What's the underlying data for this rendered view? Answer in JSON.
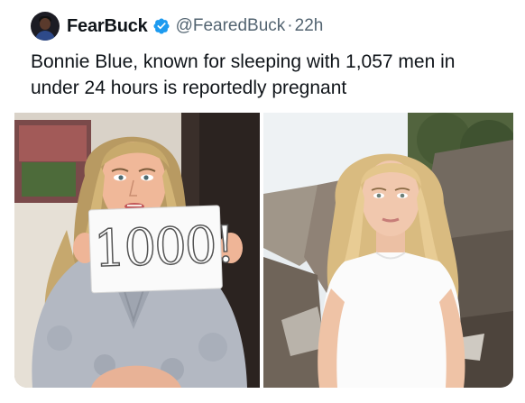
{
  "tweet": {
    "author_name": "FearBuck",
    "handle": "@FearedBuck",
    "separator": "·",
    "time": "22h",
    "text": "Bonnie Blue, known for sleeping with 1,057 men in under 24 hours is reportedly pregnant"
  },
  "media": {
    "left_photo": {
      "sign_text": "1000!"
    }
  },
  "colors": {
    "verified_blue": "#1d9bf0",
    "text_primary": "#0f1419",
    "text_secondary": "#536471"
  },
  "icons": {
    "verified": "verified-badge-icon"
  }
}
